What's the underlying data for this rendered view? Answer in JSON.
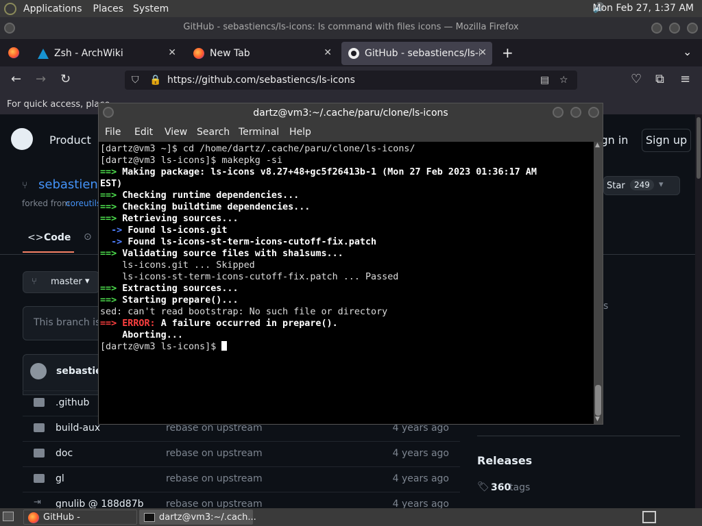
{
  "panel": {
    "menus": [
      "Applications",
      "Places",
      "System"
    ],
    "clock": "Mon Feb 27, 1:37 AM"
  },
  "firefox": {
    "window_title": "GitHub - sebastiencs/ls-icons: ls command with files icons — Mozilla Firefox",
    "tabs": [
      {
        "label": "Zsh - ArchWiki"
      },
      {
        "label": "New Tab"
      },
      {
        "label": "GitHub - sebastiencs/ls-icon"
      }
    ],
    "url": "https://github.com/sebastiencs/ls-icons",
    "bookmark_text": "For quick access, place"
  },
  "github": {
    "nav_product": "Product",
    "sign_in": "ign in",
    "sign_up": "Sign up",
    "repo_name": "sebastien",
    "forked_from_prefix": "forked from",
    "forked_from_link": "coreutils",
    "star_label": "Star",
    "star_count": "249",
    "code_tab": "Code",
    "branch": "master",
    "branch_notice": "This branch is",
    "author": "sebastien",
    "partial_s": "s",
    "files": [
      {
        "name": ".github",
        "message": "",
        "time": ""
      },
      {
        "name": "build-aux",
        "message": "rebase on upstream",
        "time": "4 years ago"
      },
      {
        "name": "doc",
        "message": "rebase on upstream",
        "time": "4 years ago"
      },
      {
        "name": "gl",
        "message": "rebase on upstream",
        "time": "4 years ago"
      },
      {
        "name": "gnulib @ 188d87b",
        "message": "rebase on upstream",
        "time": "4 years ago"
      }
    ],
    "releases_title": "Releases",
    "tags_count": "360",
    "tags_label": "tags"
  },
  "terminal": {
    "title": "dartz@vm3:~/.cache/paru/clone/ls-icons",
    "menu": [
      "File",
      "Edit",
      "View",
      "Search",
      "Terminal",
      "Help"
    ],
    "l1": "[dartz@vm3 ~]$ cd /home/dartz/.cache/paru/clone/ls-icons/",
    "l2": "[dartz@vm3 ls-icons]$ makepkg -si",
    "arrow": "==>",
    "sub_arrow": "->",
    "l3": "Making package: ls-icons v8.27+48+gc5f26413b-1 (Mon 27 Feb 2023 01:36:17 AM",
    "l4": "EST)",
    "l5": "Checking runtime dependencies...",
    "l6": "Checking buildtime dependencies...",
    "l7": "Retrieving sources...",
    "l8": "Found ls-icons.git",
    "l9": "Found ls-icons-st-term-icons-cutoff-fix.patch",
    "l10": "Validating source files with sha1sums...",
    "l11": "    ls-icons.git ... Skipped",
    "l12": "    ls-icons-st-term-icons-cutoff-fix.patch ... Passed",
    "l13": "Extracting sources...",
    "l14": "Starting prepare()...",
    "l15": "sed: can't read bootstrap: No such file or directory",
    "l16_err": "ERROR:",
    "l16": "A failure occurred in prepare().",
    "l17": "    Aborting...",
    "l18": "[dartz@vm3 ls-icons]$ "
  },
  "taskbar": {
    "items": [
      "GitHub - sebastienc...",
      "dartz@vm3:~/.cach..."
    ]
  },
  "colors": {
    "accent_green": "#4ee04e",
    "error_red": "#ff4040",
    "link_blue": "#4493f8"
  }
}
